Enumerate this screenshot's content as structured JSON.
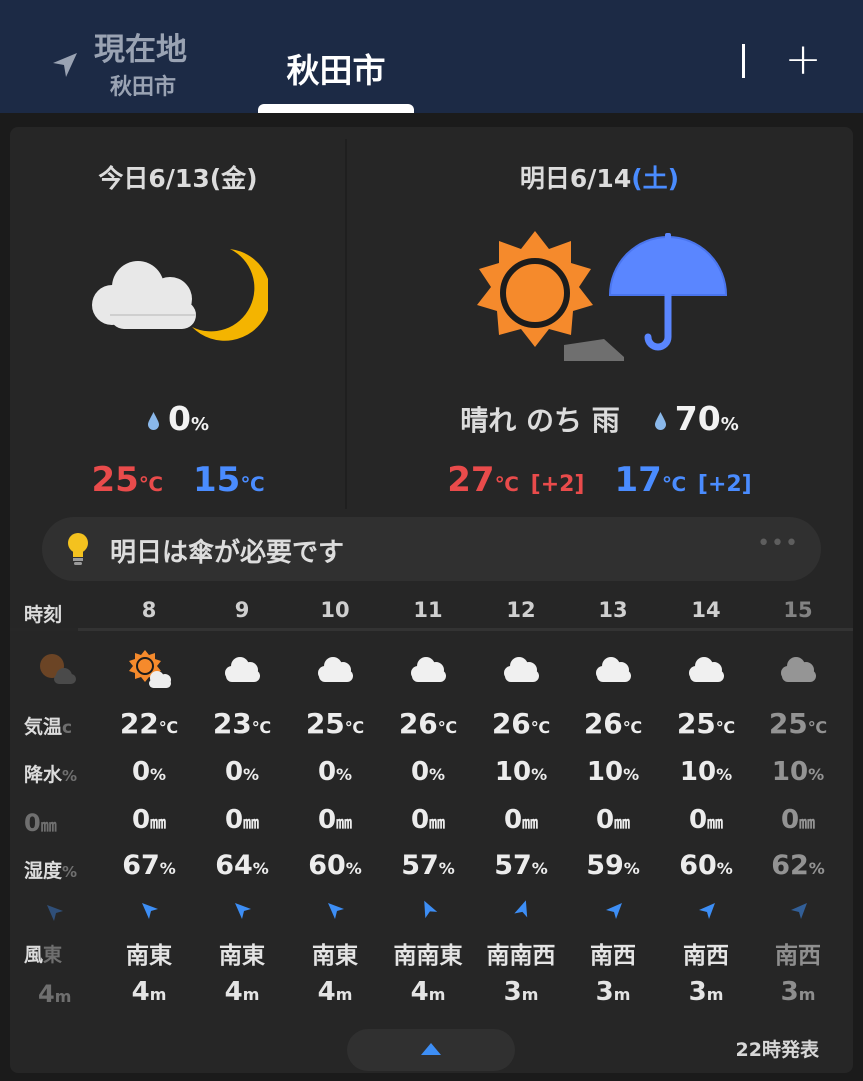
{
  "header": {
    "current_tab": {
      "title": "現在地",
      "subtitle": "秋田市",
      "icon": "location-arrow-icon"
    },
    "active_tab": {
      "label": "秋田市"
    },
    "add_label": "+"
  },
  "today": {
    "title": "今日6/13(金)",
    "icon": "cloudy-night-icon",
    "pop": "0",
    "pop_unit": "%",
    "high": "25",
    "low": "15",
    "temp_unit": "℃"
  },
  "tomorrow": {
    "title_prefix": "明日6/14",
    "title_dow": "(土)",
    "icon": "sunny-then-rain-icon",
    "weather": "晴れ のち 雨",
    "pop": "70",
    "pop_unit": "%",
    "high": "27",
    "high_diff": "[+2]",
    "low": "17",
    "low_diff": "[+2]",
    "temp_unit": "℃"
  },
  "tip": {
    "text": "明日は傘が必要です",
    "more": "•••"
  },
  "hourly": {
    "labels": {
      "time": "時刻",
      "temp": "気温",
      "pop": "降水",
      "humidity": "湿度",
      "wind": "風"
    },
    "hidden_col": {
      "temp_unit": "c",
      "pop_tail": "%",
      "precip": "0",
      "hum_tail": "%",
      "wdir": "東",
      "wspd": "4"
    },
    "hours": [
      {
        "hour": "8",
        "icon": "sun-cloud-icon",
        "temp": "22",
        "pop": "0",
        "precip": "0",
        "hum": "67",
        "wdir": "南東",
        "wspd": "4"
      },
      {
        "hour": "9",
        "icon": "cloud-icon",
        "temp": "23",
        "pop": "0",
        "precip": "0",
        "hum": "64",
        "wdir": "南東",
        "wspd": "4"
      },
      {
        "hour": "10",
        "icon": "cloud-icon",
        "temp": "25",
        "pop": "0",
        "precip": "0",
        "hum": "60",
        "wdir": "南東",
        "wspd": "4"
      },
      {
        "hour": "11",
        "icon": "cloud-icon",
        "temp": "26",
        "pop": "0",
        "precip": "0",
        "hum": "57",
        "wdir": "南南東",
        "wspd": "4"
      },
      {
        "hour": "12",
        "icon": "cloud-icon",
        "temp": "26",
        "pop": "10",
        "precip": "0",
        "hum": "57",
        "wdir": "南南西",
        "wspd": "3"
      },
      {
        "hour": "13",
        "icon": "cloud-icon",
        "temp": "26",
        "pop": "10",
        "precip": "0",
        "hum": "59",
        "wdir": "南西",
        "wspd": "3"
      },
      {
        "hour": "14",
        "icon": "cloud-icon",
        "temp": "25",
        "pop": "10",
        "precip": "0",
        "hum": "60",
        "wdir": "南西",
        "wspd": "3"
      },
      {
        "hour": "15",
        "icon": "cloud-icon",
        "temp": "25",
        "pop": "10",
        "precip": "0",
        "hum": "62",
        "wdir": "南西",
        "wspd": "3"
      }
    ],
    "units": {
      "temp": "℃",
      "pct": "%",
      "mm": "㎜",
      "m": "m"
    }
  },
  "footer": {
    "issued": "22時発表"
  },
  "colors": {
    "header_bg": "#1c2a45",
    "card_bg": "#262626",
    "high": "#e94b4b",
    "low": "#4a8cff",
    "wind_arrow": "#3d8ef5"
  }
}
